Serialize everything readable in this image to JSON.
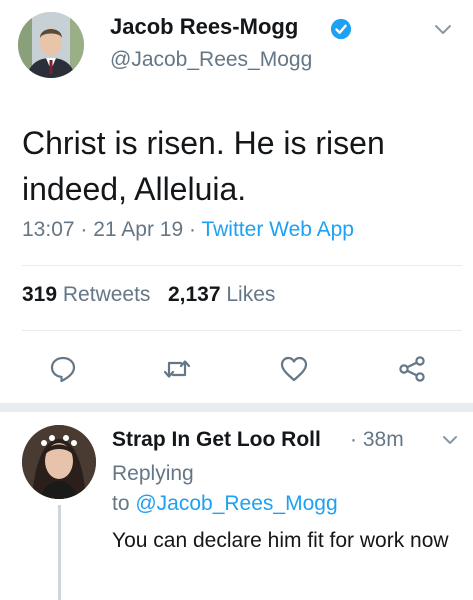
{
  "tweet": {
    "author_name": "Jacob Rees-Mogg",
    "handle": "@Jacob_Rees_Mogg",
    "text": "Christ is risen. He is risen indeed, Alleluia.",
    "time": "13:07",
    "separator": "·",
    "date": "21 Apr 19",
    "source": "Twitter Web App",
    "retweet_count": "319",
    "retweet_label": "Retweets",
    "like_count": "2,137",
    "like_label": "Likes",
    "icons": {
      "verified": "verified-badge-icon",
      "menu": "chevron-down-icon",
      "reply": "reply-icon",
      "retweet": "retweet-icon",
      "like": "heart-icon",
      "share": "share-icon"
    }
  },
  "reply": {
    "author_name": "Strap In Get Loo Roll",
    "time_separator": "·",
    "time": "38m",
    "replying_label": "Replying",
    "to_label": "to",
    "to_handle": "@Jacob_Rees_Mogg",
    "text": "You can declare him fit for work now"
  },
  "colors": {
    "accent": "#1da1f2",
    "secondary_text": "#657786",
    "primary_text": "#14171a",
    "divider": "#e6ecf0"
  }
}
